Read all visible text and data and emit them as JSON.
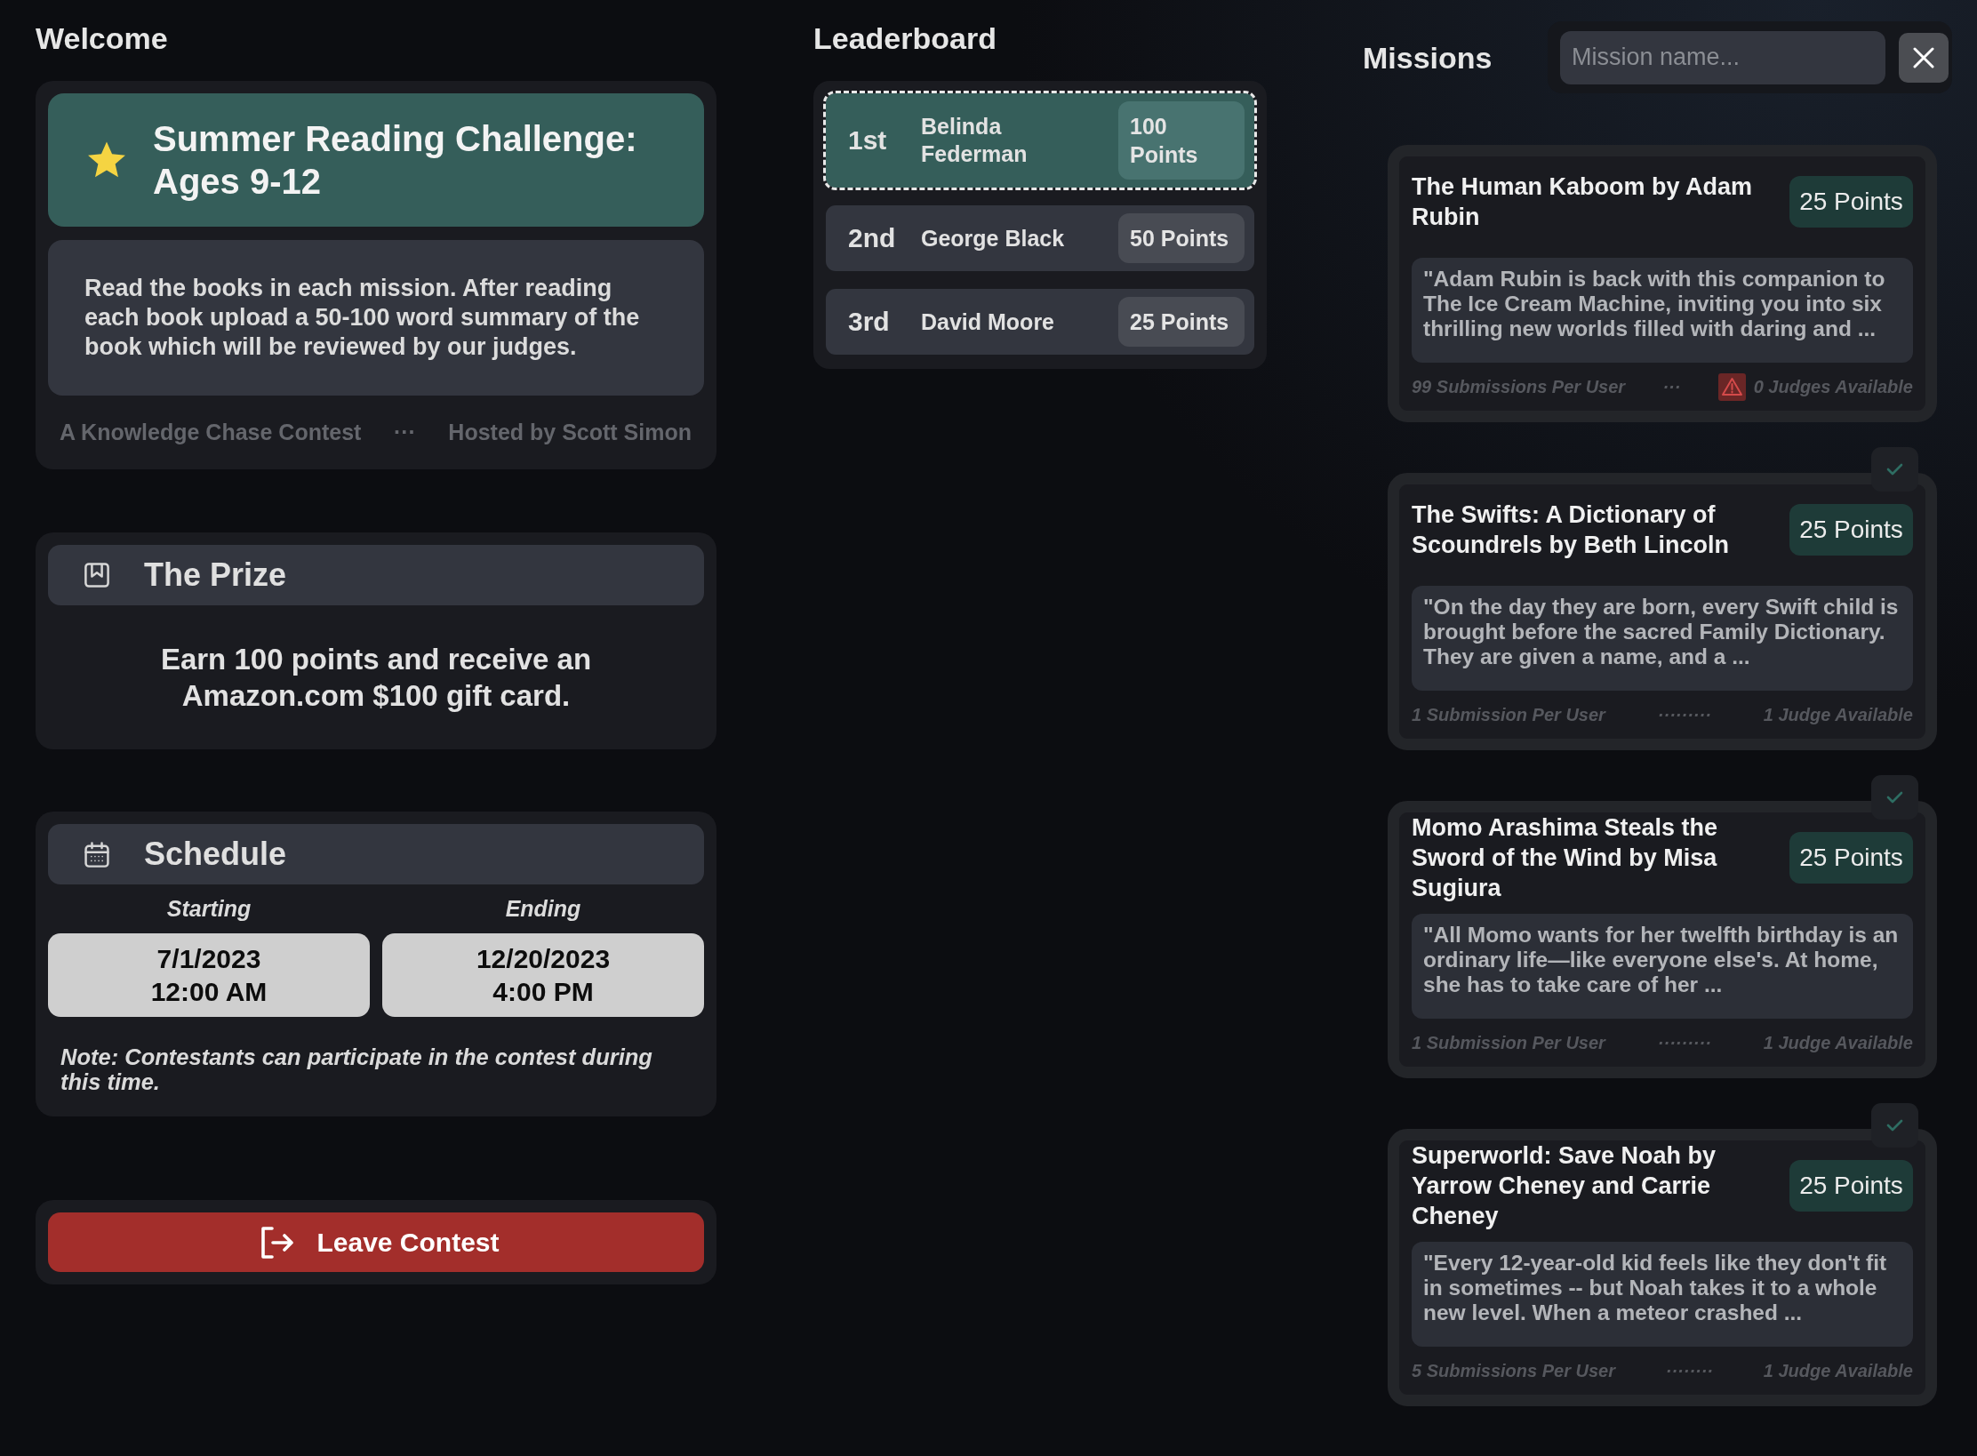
{
  "welcome": {
    "heading": "Welcome",
    "contest": {
      "title": "Summer Reading Challenge: Ages 9-12",
      "description": "Read the books in each mission. After reading each book upload a 50-100 word summary of the book which will be reviewed by our judges.",
      "organizer": "A Knowledge Chase Contest",
      "separator": "···",
      "host": "Hosted by Scott Simon"
    },
    "prize": {
      "heading": "The Prize",
      "text": "Earn 100 points and receive an Amazon.com $100 gift card."
    },
    "schedule": {
      "heading": "Schedule",
      "dates": [
        {
          "label": "Starting",
          "date": "7/1/2023",
          "time": "12:00 AM"
        },
        {
          "label": "Ending",
          "date": "12/20/2023",
          "time": "4:00 PM"
        }
      ],
      "note": "Note: Contestants can participate in the contest during this time."
    },
    "leave_button": "Leave Contest"
  },
  "leaderboard": {
    "heading": "Leaderboard",
    "entries": [
      {
        "rank": "1st",
        "name": "Belinda Federman",
        "points": "100 Points",
        "highlighted": true
      },
      {
        "rank": "2nd",
        "name": "George Black",
        "points": "50 Points",
        "highlighted": false
      },
      {
        "rank": "3rd",
        "name": "David Moore",
        "points": "25 Points",
        "highlighted": false
      }
    ]
  },
  "missions": {
    "heading": "Missions",
    "search": {
      "placeholder": "Mission name..."
    },
    "items": [
      {
        "title": "The Human Kaboom by Adam Rubin",
        "points": "25 Points",
        "description": "\"Adam Rubin is back with this companion to The Ice Cream Machine, inviting you into six thrilling new worlds filled with daring and ...",
        "submissions": "99 Submissions Per User",
        "separator": "···",
        "judges": "0 Judges Available",
        "warning": true,
        "checked": false
      },
      {
        "title": "The Swifts: A Dictionary of Scoundrels by Beth Lincoln",
        "points": "25 Points",
        "description": "\"On the day they are born, every Swift child is brought before the sacred Family Dictionary. They are given a name, and a ...",
        "submissions": "1 Submission Per User",
        "separator": "·········",
        "judges": "1 Judge Available",
        "warning": false,
        "checked": true
      },
      {
        "title": "Momo Arashima Steals the Sword of the Wind by Misa Sugiura",
        "points": "25 Points",
        "description": "\"All Momo wants for her twelfth birthday is an ordinary life—like everyone else's. At home, she has to take care of her ...",
        "submissions": "1 Submission Per User",
        "separator": "·········",
        "judges": "1 Judge Available",
        "warning": false,
        "checked": true
      },
      {
        "title": "Superworld: Save Noah by Yarrow Cheney and Carrie Cheney",
        "points": "25 Points",
        "description": "\"Every 12-year-old kid feels like they don't fit in sometimes -- but Noah takes it to a whole new level. When a meteor crashed ...",
        "submissions": "5 Submissions Per User",
        "separator": "········",
        "judges": "1 Judge Available",
        "warning": false,
        "checked": true
      }
    ]
  }
}
